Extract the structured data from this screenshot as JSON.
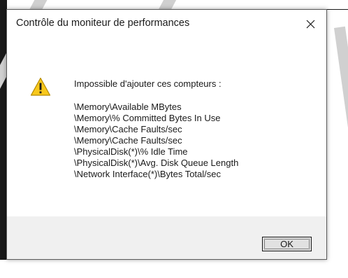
{
  "dialog": {
    "title": "Contrôle du moniteur de performances",
    "close_icon": "close-icon",
    "icon": "warning-icon",
    "heading": "Impossible d'ajouter ces compteurs :",
    "counters": [
      "\\Memory\\Available MBytes",
      "\\Memory\\% Committed Bytes In Use",
      "\\Memory\\Cache Faults/sec",
      "\\Memory\\Cache Faults/sec",
      "\\PhysicalDisk(*)\\% Idle Time",
      "\\PhysicalDisk(*)\\Avg. Disk Queue Length",
      "\\Network Interface(*)\\Bytes Total/sec"
    ],
    "ok_label": "OK"
  },
  "colors": {
    "warning_fill": "#f8c81c",
    "warning_stroke": "#b58a00",
    "footer_bg": "#f0f0f0",
    "button_bg": "#e1e1e1"
  }
}
